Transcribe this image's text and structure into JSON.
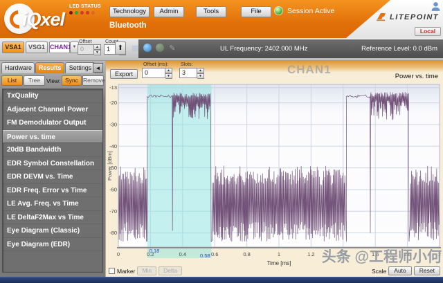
{
  "header": {
    "logo_text": "iQxel",
    "led_status_label": "LED STATUS",
    "led_colors": [
      "#7e1111",
      "#35a23a",
      "#d03a2a",
      "#d03a2a",
      "#e0662a"
    ],
    "menu_buttons": [
      "Technology",
      "Admin",
      "Tools",
      "File"
    ],
    "session_status": "Session Active",
    "brand": "LITEPOINT",
    "local_button": "Local",
    "tab_label": "Bluetooth"
  },
  "instrument_bar": {
    "vsa_button": "VSA1",
    "vsg_button": "VSG1",
    "channel_select": "CHAN1",
    "offset_label": "Offset",
    "offset_value": "0",
    "count_label": "Count",
    "count_value": "1",
    "ul_frequency": "UL Frequency: 2402.000 MHz",
    "reference_level": "Reference Level: 0.0 dBm"
  },
  "sidebar": {
    "tabs": [
      "Hardware",
      "Results",
      "Settings"
    ],
    "active_tab": "Results",
    "list_button": "List",
    "tree_button": "Tree",
    "view_label": "View:",
    "sync_button": "Sync",
    "remove_button": "Remove",
    "items": [
      "TxQuality",
      "Adjacent Channel Power",
      "FM Demodulator Output",
      "Power vs. time",
      "20dB Bandwidth",
      "EDR Symbol Constellation",
      "EDR DEVM vs. Time",
      "EDR Freq. Error vs Time",
      "LE Avg. Freq. vs Time",
      "LE DeltaF2Max vs Time",
      "Eye Diagram (Classic)",
      "Eye Diagram (EDR)"
    ],
    "selected_item": "Power vs. time"
  },
  "chart_panel": {
    "export_button": "Export",
    "offset_ms_label": "Offset (ms):",
    "offset_ms_value": "0",
    "slots_label": "Slots:",
    "slots_value": "3",
    "watermark_channel": "CHAN1",
    "title": "Power vs. time",
    "marker_checkbox_label": "Marker",
    "min_button": "Min",
    "delta_button": "Delta",
    "scale_label": "Scale",
    "auto_button": "Auto",
    "reset_button": "Reset"
  },
  "chart_data": {
    "type": "line",
    "title": "Power vs. time",
    "xlabel": "Time [ms]",
    "ylabel": "Power [dBm]",
    "xlim": [
      0,
      2
    ],
    "ylim": [
      -86.5,
      -11.5
    ],
    "x_ticks": [
      0,
      0.2,
      0.4,
      0.6,
      0.8,
      1,
      1.2,
      1.4,
      1.6,
      1.8,
      2
    ],
    "y_ticks": [
      -13,
      -20,
      -30,
      -40,
      -50,
      -60,
      -70,
      -80
    ],
    "grid": true,
    "legend": "none",
    "trace_color": "#6d4a73",
    "marker_region": {
      "start": 0.18,
      "end": 0.58,
      "start_label": "0.18",
      "end_label": "0.58",
      "color": "#8ce4e0"
    },
    "noise_floor_dbm": {
      "top": -50,
      "bottom": -84
    },
    "noise_segments": [
      [
        0,
        0.177
      ],
      [
        0.585,
        1.413
      ],
      [
        1.817,
        2.0
      ]
    ],
    "bursts": [
      {
        "start": 0.18,
        "flat_level": -17,
        "flat_end": 0.335,
        "guard_dip": -79,
        "mod_end": 0.578,
        "mod_top": -15,
        "mod_bottom": -28
      },
      {
        "start": 1.42,
        "flat_level": -17,
        "flat_end": 1.567,
        "guard_dip": -80,
        "mod_end": 1.81,
        "mod_top": -15,
        "mod_bottom": -28
      }
    ]
  },
  "overlay_watermark": "头条 @工程师小何"
}
